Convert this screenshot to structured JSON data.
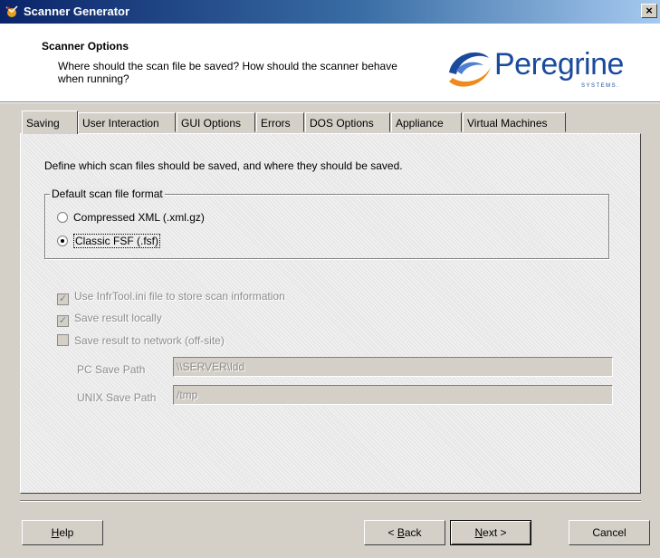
{
  "window": {
    "title": "Scanner Generator",
    "close_glyph": "×"
  },
  "header": {
    "title": "Scanner Options",
    "subtitle": "Where should the scan file be saved?  How should the scanner behave when running?",
    "logo": {
      "word": "Peregrine",
      "sub": "SYSTEMS."
    }
  },
  "tabs": [
    {
      "label": "Saving",
      "active": true
    },
    {
      "label": "User Interaction"
    },
    {
      "label": "GUI Options"
    },
    {
      "label": "Errors"
    },
    {
      "label": "DOS Options"
    },
    {
      "label": "Appliance"
    },
    {
      "label": "Virtual Machines"
    }
  ],
  "saving": {
    "intro": "Define which scan files should be saved, and where they should be saved.",
    "format_group": {
      "label": "Default scan file format",
      "options": [
        {
          "label": "Compressed XML (.xml.gz)",
          "selected": false
        },
        {
          "label": "Classic FSF (.fsf)",
          "selected": true
        }
      ]
    },
    "checks": [
      {
        "label": "Use InfrTool.ini file to store scan information",
        "checked": true,
        "enabled": false
      },
      {
        "label": "Save result locally",
        "checked": true,
        "enabled": false
      },
      {
        "label": "Save result to network (off-site)",
        "checked": false,
        "enabled": false
      }
    ],
    "pc_path": {
      "label": "PC Save Path",
      "value": "\\\\SERVER\\ldd"
    },
    "unix_path": {
      "label": "UNIX Save Path",
      "value": "/tmp"
    }
  },
  "buttons": {
    "help": {
      "pre": "",
      "key": "H",
      "post": "elp"
    },
    "back": {
      "pre": "< ",
      "key": "B",
      "post": "ack"
    },
    "next": {
      "pre": "",
      "key": "N",
      "post": "ext >"
    },
    "cancel": "Cancel"
  },
  "colors": {
    "title_start": "#0a246a",
    "title_end": "#a6caf0",
    "logo_blue": "#1a4a9c",
    "logo_orange": "#f08a1c"
  }
}
